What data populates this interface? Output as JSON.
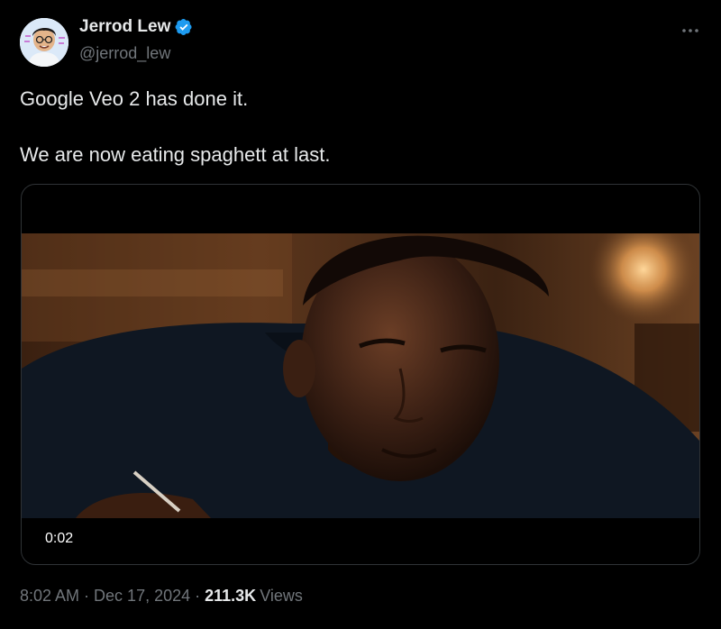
{
  "author": {
    "display_name": "Jerrod Lew",
    "handle": "@jerrod_lew",
    "verified": true,
    "avatar_icon": "profile-photo"
  },
  "tweet": {
    "paragraphs": [
      "Google Veo 2 has done it.",
      "We are now eating spaghett at last."
    ]
  },
  "media": {
    "type": "video",
    "duration_label": "0:02"
  },
  "meta": {
    "time": "8:02 AM",
    "separator": "·",
    "date": "Dec 17, 2024",
    "views_count": "211.3K",
    "views_label": "Views"
  },
  "colors": {
    "background": "#000000",
    "text": "#e7e9ea",
    "secondary": "#71767b",
    "verified": "#1d9bf0",
    "border": "#2f3336"
  },
  "icons": {
    "verified": "verified-badge-icon",
    "more": "more-options-icon"
  }
}
